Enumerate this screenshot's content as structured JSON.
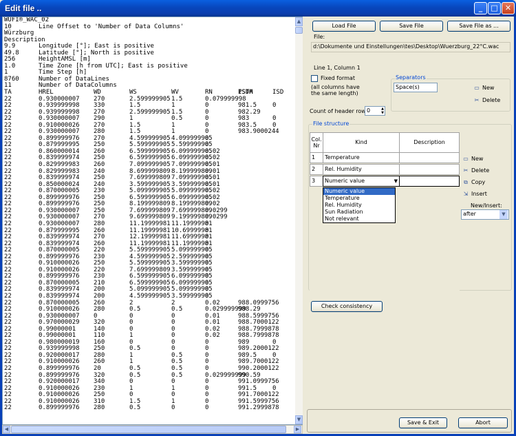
{
  "window": {
    "title": "Edit file .."
  },
  "text_lines": [
    [
      "WUFI®_WAC_02"
    ],
    [
      "10",
      "Line Offset to 'Number of Data Columns'"
    ],
    [
      "Würzburg"
    ],
    [
      "Description"
    ],
    [
      "9.9",
      "Longitude [°]; East is positive"
    ],
    [
      "49.8",
      "Latitude [°]; North is positive"
    ],
    [
      "256",
      "HeightAMSL [m]"
    ],
    [
      "1.0",
      "Time Zone [h from UTC]; East is positive"
    ],
    [
      "1",
      "Time Step [h]"
    ],
    [
      "8760",
      "Number of DataLines"
    ],
    [
      "11",
      "Number of DataColumns"
    ],
    [
      "TA",
      "HREL",
      "WD",
      "WS",
      "WV",
      "RN",
      "PSTA",
      "ISDH",
      "ISD"
    ],
    [
      "22",
      "0.930000007",
      "270",
      "2.599999905",
      "1.5",
      "0.079999998"
    ],
    [
      "22",
      "0.939999998",
      "330",
      "1.5",
      "1",
      "0",
      "981.5",
      "0"
    ],
    [
      "22",
      "0.939999998",
      "270",
      "2.599999905",
      "1.5",
      "0",
      "982.29"
    ],
    [
      "22",
      "0.930000007",
      "290",
      "1",
      "0.5",
      "0",
      "983",
      "0"
    ],
    [
      "22",
      "0.910000026",
      "270",
      "1.5",
      "1",
      "0",
      "983.5",
      "0"
    ],
    [
      "22",
      "0.930000007",
      "280",
      "1.5",
      "1",
      "0",
      "983.9000244"
    ],
    [
      "22",
      "0.899999976",
      "270",
      "4.599999905",
      "4.099999905",
      "0"
    ],
    [
      "22",
      "0.879999995",
      "250",
      "5.599999905",
      "5.599999905",
      "0"
    ],
    [
      "22",
      "0.860000014",
      "260",
      "6.599999905",
      "6.099999905",
      "0.02"
    ],
    [
      "22",
      "0.839999974",
      "250",
      "6.599999905",
      "6.099999905",
      "0.02"
    ],
    [
      "22",
      "0.829999983",
      "260",
      "7.099999905",
      "7.099999905",
      "0.01"
    ],
    [
      "22",
      "0.829999983",
      "240",
      "8.699999809",
      "8.199999809",
      "0.01"
    ],
    [
      "22",
      "0.839999974",
      "250",
      "7.699999809",
      "7.099999905",
      "0.01"
    ],
    [
      "22",
      "0.850000024",
      "240",
      "3.599999905",
      "3.599999905",
      "0.01"
    ],
    [
      "22",
      "0.870000005",
      "230",
      "5.099999905",
      "5.099999905",
      "0.02"
    ],
    [
      "22",
      "0.899999976",
      "250",
      "6.599999905",
      "6.099999905",
      "0.02"
    ],
    [
      "22",
      "0.899999976",
      "250",
      "8.199999809",
      "8.199999809",
      "0.02"
    ],
    [
      "22",
      "0.930000007",
      "250",
      "7.699999809",
      "7.699999809",
      "0.0299"
    ],
    [
      "22",
      "0.930000007",
      "270",
      "9.699999809",
      "9.199999809",
      "0.0299"
    ],
    [
      "22",
      "0.930000007",
      "280",
      "11.19999981",
      "11.19999981",
      "0"
    ],
    [
      "22",
      "0.879999995",
      "260",
      "11.19999981",
      "10.69999981",
      "0"
    ],
    [
      "22",
      "0.839999974",
      "270",
      "12.19999981",
      "11.69999981",
      "0"
    ],
    [
      "22",
      "0.839999974",
      "260",
      "11.19999981",
      "11.19999981",
      "0"
    ],
    [
      "22",
      "0.870000005",
      "220",
      "5.599999905",
      "5.099999905",
      "0"
    ],
    [
      "22",
      "0.899999976",
      "230",
      "4.599999905",
      "2.599999905",
      "0"
    ],
    [
      "22",
      "0.910000026",
      "250",
      "5.599999905",
      "3.599999905",
      "0"
    ],
    [
      "22",
      "0.910000026",
      "220",
      "7.699999809",
      "3.599999905",
      "0"
    ],
    [
      "22",
      "0.899999976",
      "230",
      "6.599999905",
      "6.099999905",
      "0"
    ],
    [
      "22",
      "0.870000005",
      "210",
      "6.599999905",
      "6.099999905",
      "0"
    ],
    [
      "22",
      "0.839999974",
      "200",
      "5.099999905",
      "5.099999905",
      "0"
    ],
    [
      "22",
      "0.839999974",
      "200",
      "4.599999905",
      "3.599999905",
      "0"
    ],
    [
      "22",
      "0.870000005",
      "260",
      "2",
      "2",
      "0.02",
      "988.0999756"
    ],
    [
      "22",
      "0.910000026",
      "280",
      "0.5",
      "0.5",
      "0.029999999",
      "988.29"
    ],
    [
      "22",
      "0.930000007",
      "0",
      "0",
      "0",
      "0.01",
      "988.5999756"
    ],
    [
      "22",
      "0.970000029",
      "320",
      "0",
      "0",
      "0.01",
      "988.7000122"
    ],
    [
      "22",
      "0.99000001",
      "140",
      "0",
      "0",
      "0.02",
      "988.7999878"
    ],
    [
      "22",
      "0.99000001",
      "110",
      "1",
      "0",
      "0.02",
      "988.7999878"
    ],
    [
      "22",
      "0.980000019",
      "160",
      "0",
      "0",
      "0",
      "989",
      "0"
    ],
    [
      "22",
      "0.939999998",
      "250",
      "0.5",
      "0",
      "0",
      "989.2000122"
    ],
    [
      "22",
      "0.920000017",
      "280",
      "1",
      "0.5",
      "0",
      "989.5",
      "0"
    ],
    [
      "22",
      "0.910000026",
      "260",
      "1",
      "0.5",
      "0",
      "989.7000122"
    ],
    [
      "22",
      "0.899999976",
      "20",
      "0.5",
      "0.5",
      "0",
      "990.2000122"
    ],
    [
      "22",
      "0.899999976",
      "320",
      "0.5",
      "0.5",
      "0.029999999",
      "990.59"
    ],
    [
      "22",
      "0.920000017",
      "340",
      "0",
      "0",
      "0",
      "991.0999756"
    ],
    [
      "22",
      "0.910000026",
      "230",
      "1",
      "1",
      "0",
      "991.5",
      "0"
    ],
    [
      "22",
      "0.910000026",
      "250",
      "0",
      "0",
      "0",
      "991.7000122"
    ],
    [
      "22",
      "0.910000026",
      "310",
      "1.5",
      "1",
      "0",
      "991.5999756"
    ],
    [
      "22",
      "0.899999976",
      "280",
      "0.5",
      "0",
      "0",
      "991.2999878"
    ]
  ],
  "toolbar": {
    "load": "Load File",
    "save": "Save File",
    "save_as": "Save File as ..."
  },
  "file": {
    "label": "File:",
    "path": "d:\\Dokumente und Einstellungen\\tes\\Desktop\\Wuerzburg_22°C.wac"
  },
  "cursor_position": "Line 1, Column 1",
  "fixed_format": {
    "label": "Fixed format",
    "note_line1": "(all columns have",
    "note_line2": "the same length)",
    "checked": false
  },
  "separators": {
    "title": "Separators",
    "value": "Space(s)",
    "new": "New",
    "delete": "Delete"
  },
  "header_rows": {
    "label": "Count of header rows",
    "value": "0"
  },
  "file_structure": {
    "title": "File structure",
    "columns": {
      "nr_line1": "Col.",
      "nr_line2": "Nr",
      "kind": "Kind",
      "description": "Description"
    },
    "rows": [
      {
        "nr": "1",
        "kind": "Temperature",
        "description": ""
      },
      {
        "nr": "2",
        "kind": "Rel. Humidity",
        "description": ""
      },
      {
        "nr": "3",
        "kind": "Numeric value",
        "description": ""
      }
    ],
    "dropdown_options": [
      "Numeric value",
      "Temperature",
      "Rel. Humidity",
      "Sun Radiation",
      "Not relevant"
    ],
    "selected_option": "Numeric value",
    "actions": {
      "new": "New",
      "delete": "Delete",
      "copy": "Copy",
      "insert": "Insert",
      "new_insert_label": "New/Insert:",
      "new_insert_value": "after"
    }
  },
  "check_consistency": "Check consistency",
  "footer": {
    "save_exit": "Save & Exit",
    "abort": "Abort"
  },
  "colors": {
    "title_bar": "#0a47c4",
    "selection": "#316ac5",
    "group_label": "#0046d5"
  }
}
